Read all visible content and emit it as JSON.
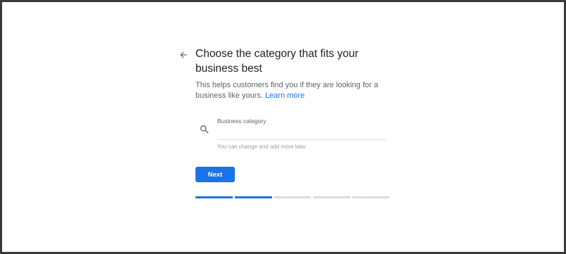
{
  "header": {
    "title": "Choose the category that fits your business best",
    "subtitle": "This helps customers find you if they are looking for a business like yours.",
    "learn_more": "Learn more"
  },
  "category_field": {
    "label": "Business category",
    "value": "",
    "placeholder": "",
    "helper": "You can change and add more later"
  },
  "actions": {
    "next_label": "Next"
  },
  "progress": {
    "total_steps": 5,
    "completed_steps": 2
  },
  "icons": {
    "back": "arrow-left-icon",
    "search": "search-icon"
  },
  "colors": {
    "accent": "#1a73e8",
    "inactive": "#dadce0"
  }
}
